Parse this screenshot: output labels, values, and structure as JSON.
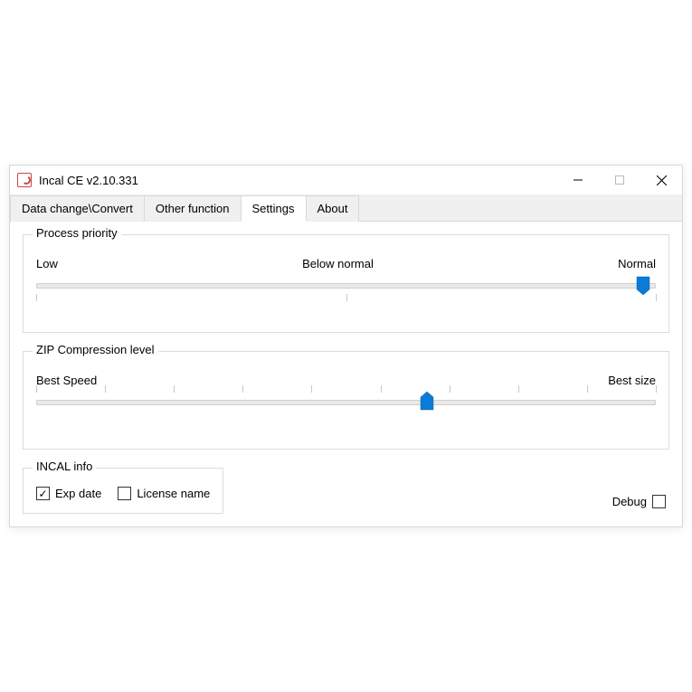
{
  "window": {
    "title": "Incal CE v2.10.331"
  },
  "tabs": {
    "data_change": "Data change\\Convert",
    "other_function": "Other function",
    "settings": "Settings",
    "about": "About",
    "active": "settings"
  },
  "priority": {
    "legend": "Process priority",
    "low": "Low",
    "below_normal": "Below normal",
    "normal": "Normal",
    "value_percent": 98,
    "tick_count": 3
  },
  "zip": {
    "legend": "ZIP Compression level",
    "best_speed": "Best Speed",
    "best_size": "Best size",
    "value_percent": 63,
    "tick_count": 10
  },
  "incal": {
    "legend": "INCAL info",
    "exp_date_label": "Exp date",
    "exp_date_checked": true,
    "license_name_label": "License name",
    "license_name_checked": false
  },
  "debug": {
    "label": "Debug",
    "checked": false
  },
  "colors": {
    "accent": "#0a7bd6"
  }
}
